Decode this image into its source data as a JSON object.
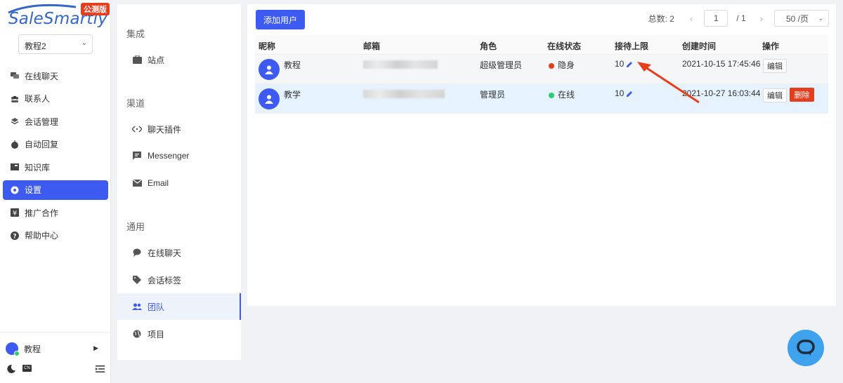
{
  "brand": {
    "name": "SaleSmartly",
    "badge": "公测版"
  },
  "workspace": {
    "selected": "教程2"
  },
  "nav": {
    "items": [
      {
        "label": "在线聊天",
        "icon": "chat-bubbles-icon"
      },
      {
        "label": "联系人",
        "icon": "contacts-icon"
      },
      {
        "label": "会话管理",
        "icon": "layers-icon"
      },
      {
        "label": "自动回复",
        "icon": "robot-icon"
      },
      {
        "label": "知识库",
        "icon": "book-icon"
      },
      {
        "label": "设置",
        "icon": "settings-icon"
      },
      {
        "label": "推广合作",
        "icon": "yen-icon"
      },
      {
        "label": "帮助中心",
        "icon": "help-icon"
      }
    ],
    "active": "设置"
  },
  "user": {
    "name": "教程"
  },
  "bottom": {
    "lang_badge": "CN"
  },
  "subnav": {
    "sections": [
      {
        "title": "集成",
        "items": [
          {
            "label": "站点",
            "icon": "briefcase-icon"
          }
        ]
      },
      {
        "title": "渠道",
        "items": [
          {
            "label": "聊天插件",
            "icon": "code-icon"
          },
          {
            "label": "Messenger",
            "icon": "message-square-icon"
          },
          {
            "label": "Email",
            "icon": "mail-icon"
          }
        ]
      },
      {
        "title": "通用",
        "items": [
          {
            "label": "在线聊天",
            "icon": "chat-icon"
          },
          {
            "label": "会话标签",
            "icon": "tag-icon"
          },
          {
            "label": "团队",
            "icon": "team-icon"
          },
          {
            "label": "项目",
            "icon": "globe-icon"
          }
        ]
      }
    ],
    "active": "团队"
  },
  "toolbar": {
    "add_user_label": "添加用户"
  },
  "pagination": {
    "total_label": "总数: 2",
    "current_page": "1",
    "of_label": "/ 1",
    "page_size": "50 /页"
  },
  "table": {
    "headers": {
      "nickname": "昵称",
      "email": "邮箱",
      "role": "角色",
      "status": "在线状态",
      "limit": "接待上限",
      "created": "创建时间",
      "actions": "操作"
    },
    "rows": [
      {
        "nickname": "教程",
        "role": "超级管理员",
        "status": "隐身",
        "status_color": "#e53e1d",
        "limit": "10",
        "created": "2021-10-15 17:45:46",
        "edit": "编辑",
        "delete": null
      },
      {
        "nickname": "教学",
        "role": "管理员",
        "status": "在线",
        "status_color": "#2ecc71",
        "limit": "10",
        "created": "2021-10-27 16:03:44",
        "edit": "编辑",
        "delete": "删除"
      }
    ]
  },
  "colors": {
    "primary": "#3d5af1",
    "danger": "#e53e1d",
    "online": "#2ecc71",
    "chat_widget": "#3ea2ec"
  }
}
